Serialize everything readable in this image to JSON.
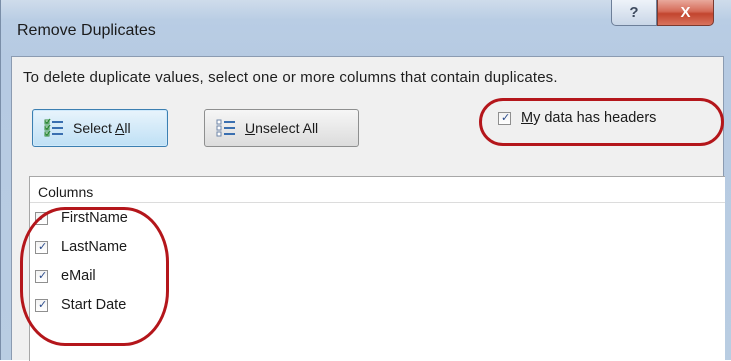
{
  "window": {
    "title": "Remove Duplicates",
    "help_glyph": "?",
    "close_glyph": "X"
  },
  "dialog": {
    "instruction": "To delete duplicate values, select one or more columns that contain duplicates.",
    "select_all": {
      "pre": "Select ",
      "mnemonic": "A",
      "post": "ll",
      "icon": "select-all-icon"
    },
    "unselect_all": {
      "mnemonic": "U",
      "post": "nselect All",
      "icon": "unselect-all-icon"
    },
    "has_headers": {
      "checked": true,
      "mnemonic": "M",
      "post": "y data has headers"
    },
    "columns": {
      "header": "Columns",
      "items": [
        {
          "label": "FirstName",
          "checked": true
        },
        {
          "label": "LastName",
          "checked": true
        },
        {
          "label": "eMail",
          "checked": true
        },
        {
          "label": "Start Date",
          "checked": true
        }
      ]
    }
  },
  "colors": {
    "annotation": "#b4161b",
    "title_bar": "#b9cde4",
    "close_button": "#c2452f",
    "select_all_button": "#bfe0f5"
  }
}
